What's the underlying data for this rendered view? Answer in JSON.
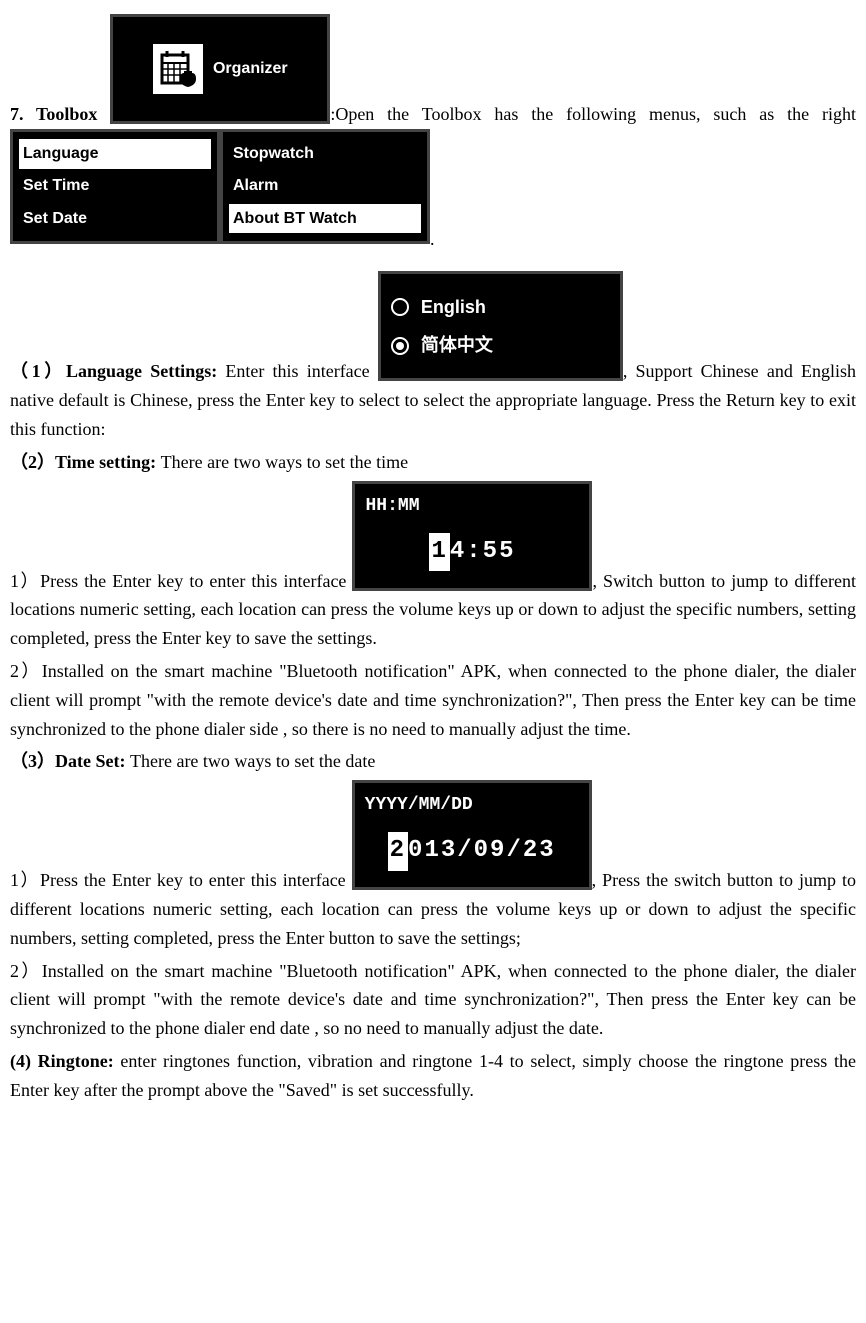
{
  "s7": {
    "heading": "7. Toolbox ",
    "after_img1": ":Open the Toolbox has the following menus, such as the right ",
    "period": "."
  },
  "organizer": {
    "label": "Organizer"
  },
  "menu1": {
    "i0": "Language",
    "i1": "Set Time",
    "i2": "Set Date"
  },
  "menu2": {
    "i0": "Stopwatch",
    "i1": "Alarm",
    "i2": "About BT Watch"
  },
  "s1": {
    "heading": "（1）Language Settings: ",
    "text1": "Enter this interface ",
    "text2": ", Support Chinese and English native default is Chinese, press the Enter key to select to select the appropriate language. Press the Return key to exit this function:"
  },
  "lang": {
    "opt0": "English",
    "opt1": "简体中文"
  },
  "s2": {
    "heading": "（2）Time setting: ",
    "text1": "There are two ways to set the time",
    "p1a": "1）Press the Enter key to enter this interface ",
    "p1b": ", Switch button to jump to different locations numeric setting, each location can press the volume keys up or down to adjust the specific numbers, setting completed, press the Enter key to save the settings.",
    "p2": "2）Installed on the smart machine \"Bluetooth notification\" APK, when connected to the phone dialer, the dialer client will prompt \"with the remote device's date and time synchronization?\", Then press the Enter key can be time synchronized to the phone dialer side , so there is no need to manually adjust the time."
  },
  "time": {
    "header": "HH:MM",
    "h_digit": "1",
    "rest": "4:55"
  },
  "s3": {
    "heading": "（3）Date Set: ",
    "text1": "There are two ways to set the date",
    "p1a": "1）Press the Enter key to enter this interface ",
    "p1b": ", Press the switch button to jump to different locations numeric setting, each location can press the volume keys up or down to adjust the specific numbers, setting completed, press the Enter button to save the settings;",
    "p2": "2）Installed on the smart machine \"Bluetooth notification\" APK, when connected to the phone dialer, the dialer client will prompt \"with the remote device's date and time synchronization?\", Then press the Enter key can be synchronized to the phone dialer end date , so no need to manually adjust the date."
  },
  "date": {
    "header": "YYYY/MM/DD",
    "h_digit": "2",
    "rest": "013/09/23"
  },
  "s4": {
    "heading": "(4) Ringtone: ",
    "text": "enter ringtones function, vibration and ringtone 1-4 to select, simply choose the ringtone press the Enter key after the prompt above the \"Saved\" is set successfully."
  }
}
